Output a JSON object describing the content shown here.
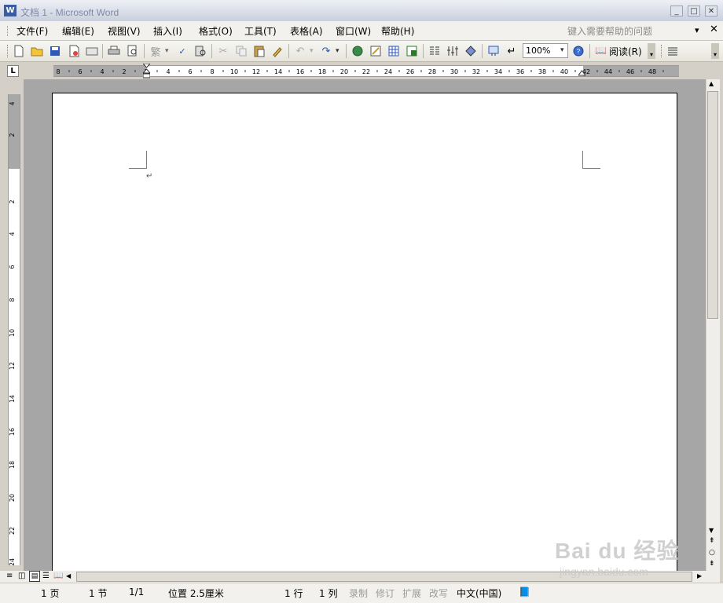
{
  "window": {
    "title": "文档 1 - Microsoft Word",
    "app_icon": "word-icon",
    "controls": [
      "minimize-icon",
      "maximize-icon",
      "close-icon"
    ]
  },
  "menu": {
    "items": [
      "文件(F)",
      "编辑(E)",
      "视图(V)",
      "插入(I)",
      "格式(O)",
      "工具(T)",
      "表格(A)",
      "窗口(W)",
      "帮助(H)"
    ],
    "help_placeholder": "键入需要帮助的问题"
  },
  "toolbar": {
    "zoom": "100%",
    "read_label": "阅读(R)",
    "font_glyph": "繁"
  },
  "ruler": {
    "h_labels": [
      "8",
      "6",
      "4",
      "2",
      "2",
      "4",
      "6",
      "8",
      "10",
      "12",
      "14",
      "16",
      "18",
      "20",
      "22",
      "24",
      "26",
      "28",
      "30",
      "32",
      "34",
      "36",
      "38",
      "40",
      "42",
      "44",
      "46",
      "48"
    ],
    "v_labels": [
      "4",
      "2",
      "2",
      "4",
      "6",
      "8",
      "10",
      "12",
      "14",
      "16",
      "18",
      "20",
      "22",
      "24"
    ]
  },
  "document": {
    "paragraph_mark": "↵"
  },
  "status": {
    "page": "1 页",
    "section": "1 节",
    "page_of": "1/1",
    "position": "位置 2.5厘米",
    "line": "1 行",
    "column": "1 列",
    "rec": "录制",
    "trk": "修订",
    "ext": "扩展",
    "ovr": "改写",
    "language": "中文(中国)"
  },
  "watermark": {
    "brand": "Bai du 经验",
    "url": "jingyan.baidu.com"
  }
}
